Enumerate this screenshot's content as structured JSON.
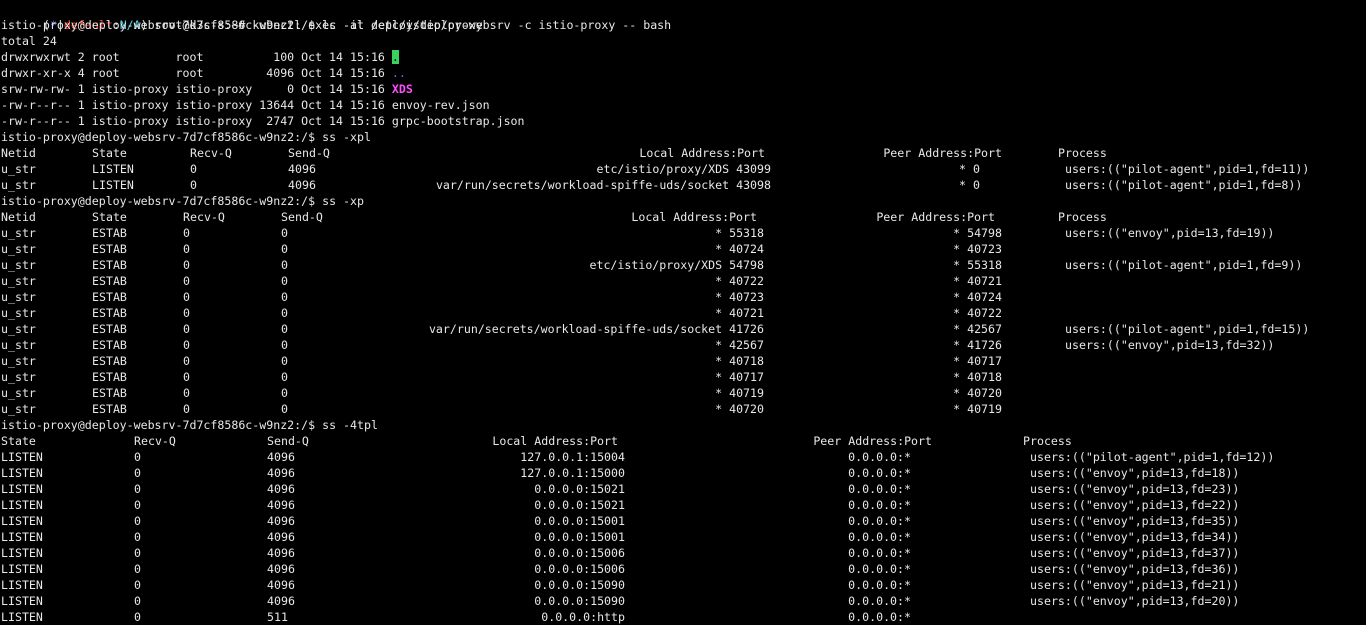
{
  "colors": {
    "background": "#000000",
    "text": "#e8e8e8",
    "context_star": "#5b73ff",
    "context_default": "#ff3b30",
    "context_na": "#5dd6e6",
    "current_dir_bg": "#3bd15e",
    "parent_dir": "#5b73ff",
    "socket": "#ff4fff"
  },
  "prompt": {
    "open_paren": "(",
    "star": "*",
    "sep1": "|",
    "context": "default",
    "colon": ":",
    "na": "N/A",
    "close_paren": ")",
    "host_prompt": " root@k3s-s:~# ",
    "command": "kubectl exec -it deploy/deploy-websrv -c istio-proxy -- bash"
  },
  "pod_prompt": "istio-proxy@deploy-websrv-7d7cf8586c-w9nz2:/$ ",
  "commands": {
    "ls": "ls -al /etc/istio/proxy",
    "ss_xpl": "ss -xpl",
    "ss_xp": "ss -xp",
    "ss_4tpl": "ss -4tpl"
  },
  "ls": {
    "total": "total 24",
    "rows": [
      {
        "prefix": "drwxrwxrwt 2 root        root          100 Oct 14 15:16 ",
        "name": "."
      },
      {
        "prefix": "drwxr-xr-x 4 root        root         4096 Oct 14 15:16 ",
        "name": ".."
      },
      {
        "prefix": "srw-rw-rw- 1 istio-proxy istio-proxy     0 Oct 14 15:16 ",
        "name": "XDS"
      },
      {
        "prefix": "-rw-r--r-- 1 istio-proxy istio-proxy 13644 Oct 14 15:16 ",
        "name": "envoy-rev.json"
      },
      {
        "prefix": "-rw-r--r-- 1 istio-proxy istio-proxy  2747 Oct 14 15:16 ",
        "name": "grpc-bootstrap.json"
      }
    ]
  },
  "ss_xpl": {
    "headers": {
      "netid": "Netid",
      "state": "State",
      "recvq": "Recv-Q",
      "sendq": "Send-Q",
      "local": "Local Address:Port",
      "peer": "Peer Address:Port",
      "process": "Process"
    },
    "rows": [
      {
        "netid": "u_str",
        "state": "LISTEN",
        "recvq": "0",
        "sendq": "4096",
        "local": "etc/istio/proxy/XDS 43099",
        "peer": "* 0",
        "process": "users:((\"pilot-agent\",pid=1,fd=11))"
      },
      {
        "netid": "u_str",
        "state": "LISTEN",
        "recvq": "0",
        "sendq": "4096",
        "local": "var/run/secrets/workload-spiffe-uds/socket 43098",
        "peer": "* 0",
        "process": "users:((\"pilot-agent\",pid=1,fd=8))"
      }
    ]
  },
  "ss_xp": {
    "headers": {
      "netid": "Netid",
      "state": "State",
      "recvq": "Recv-Q",
      "sendq": "Send-Q",
      "local": "Local Address:Port",
      "peer": "Peer Address:Port",
      "process": "Process"
    },
    "rows": [
      {
        "netid": "u_str",
        "state": "ESTAB",
        "recvq": "0",
        "sendq": "0",
        "local": "* 55318",
        "peer": "* 54798",
        "process": "users:((\"envoy\",pid=13,fd=19))"
      },
      {
        "netid": "u_str",
        "state": "ESTAB",
        "recvq": "0",
        "sendq": "0",
        "local": "* 40724",
        "peer": "* 40723",
        "process": ""
      },
      {
        "netid": "u_str",
        "state": "ESTAB",
        "recvq": "0",
        "sendq": "0",
        "local": "etc/istio/proxy/XDS 54798",
        "peer": "* 55318",
        "process": "users:((\"pilot-agent\",pid=1,fd=9))"
      },
      {
        "netid": "u_str",
        "state": "ESTAB",
        "recvq": "0",
        "sendq": "0",
        "local": "* 40722",
        "peer": "* 40721",
        "process": ""
      },
      {
        "netid": "u_str",
        "state": "ESTAB",
        "recvq": "0",
        "sendq": "0",
        "local": "* 40723",
        "peer": "* 40724",
        "process": ""
      },
      {
        "netid": "u_str",
        "state": "ESTAB",
        "recvq": "0",
        "sendq": "0",
        "local": "* 40721",
        "peer": "* 40722",
        "process": ""
      },
      {
        "netid": "u_str",
        "state": "ESTAB",
        "recvq": "0",
        "sendq": "0",
        "local": "var/run/secrets/workload-spiffe-uds/socket 41726",
        "peer": "* 42567",
        "process": "users:((\"pilot-agent\",pid=1,fd=15))"
      },
      {
        "netid": "u_str",
        "state": "ESTAB",
        "recvq": "0",
        "sendq": "0",
        "local": "* 42567",
        "peer": "* 41726",
        "process": "users:((\"envoy\",pid=13,fd=32))"
      },
      {
        "netid": "u_str",
        "state": "ESTAB",
        "recvq": "0",
        "sendq": "0",
        "local": "* 40718",
        "peer": "* 40717",
        "process": ""
      },
      {
        "netid": "u_str",
        "state": "ESTAB",
        "recvq": "0",
        "sendq": "0",
        "local": "* 40717",
        "peer": "* 40718",
        "process": ""
      },
      {
        "netid": "u_str",
        "state": "ESTAB",
        "recvq": "0",
        "sendq": "0",
        "local": "* 40719",
        "peer": "* 40720",
        "process": ""
      },
      {
        "netid": "u_str",
        "state": "ESTAB",
        "recvq": "0",
        "sendq": "0",
        "local": "* 40720",
        "peer": "* 40719",
        "process": ""
      }
    ]
  },
  "ss_4tpl": {
    "headers": {
      "state": "State",
      "recvq": "Recv-Q",
      "sendq": "Send-Q",
      "local": "Local Address:Port",
      "peer": "Peer Address:Port",
      "process": "Process"
    },
    "rows": [
      {
        "state": "LISTEN",
        "recvq": "0",
        "sendq": "4096",
        "local": "127.0.0.1:15004",
        "peer": "0.0.0.0:*",
        "process": "users:((\"pilot-agent\",pid=1,fd=12))"
      },
      {
        "state": "LISTEN",
        "recvq": "0",
        "sendq": "4096",
        "local": "127.0.0.1:15000",
        "peer": "0.0.0.0:*",
        "process": "users:((\"envoy\",pid=13,fd=18))"
      },
      {
        "state": "LISTEN",
        "recvq": "0",
        "sendq": "4096",
        "local": "0.0.0.0:15021",
        "peer": "0.0.0.0:*",
        "process": "users:((\"envoy\",pid=13,fd=23))"
      },
      {
        "state": "LISTEN",
        "recvq": "0",
        "sendq": "4096",
        "local": "0.0.0.0:15021",
        "peer": "0.0.0.0:*",
        "process": "users:((\"envoy\",pid=13,fd=22))"
      },
      {
        "state": "LISTEN",
        "recvq": "0",
        "sendq": "4096",
        "local": "0.0.0.0:15001",
        "peer": "0.0.0.0:*",
        "process": "users:((\"envoy\",pid=13,fd=35))"
      },
      {
        "state": "LISTEN",
        "recvq": "0",
        "sendq": "4096",
        "local": "0.0.0.0:15001",
        "peer": "0.0.0.0:*",
        "process": "users:((\"envoy\",pid=13,fd=34))"
      },
      {
        "state": "LISTEN",
        "recvq": "0",
        "sendq": "4096",
        "local": "0.0.0.0:15006",
        "peer": "0.0.0.0:*",
        "process": "users:((\"envoy\",pid=13,fd=37))"
      },
      {
        "state": "LISTEN",
        "recvq": "0",
        "sendq": "4096",
        "local": "0.0.0.0:15006",
        "peer": "0.0.0.0:*",
        "process": "users:((\"envoy\",pid=13,fd=36))"
      },
      {
        "state": "LISTEN",
        "recvq": "0",
        "sendq": "4096",
        "local": "0.0.0.0:15090",
        "peer": "0.0.0.0:*",
        "process": "users:((\"envoy\",pid=13,fd=21))"
      },
      {
        "state": "LISTEN",
        "recvq": "0",
        "sendq": "4096",
        "local": "0.0.0.0:15090",
        "peer": "0.0.0.0:*",
        "process": "users:((\"envoy\",pid=13,fd=20))"
      },
      {
        "state": "LISTEN",
        "recvq": "0",
        "sendq": "511",
        "local": "0.0.0.0:http",
        "peer": "0.0.0.0:*",
        "process": ""
      }
    ]
  }
}
